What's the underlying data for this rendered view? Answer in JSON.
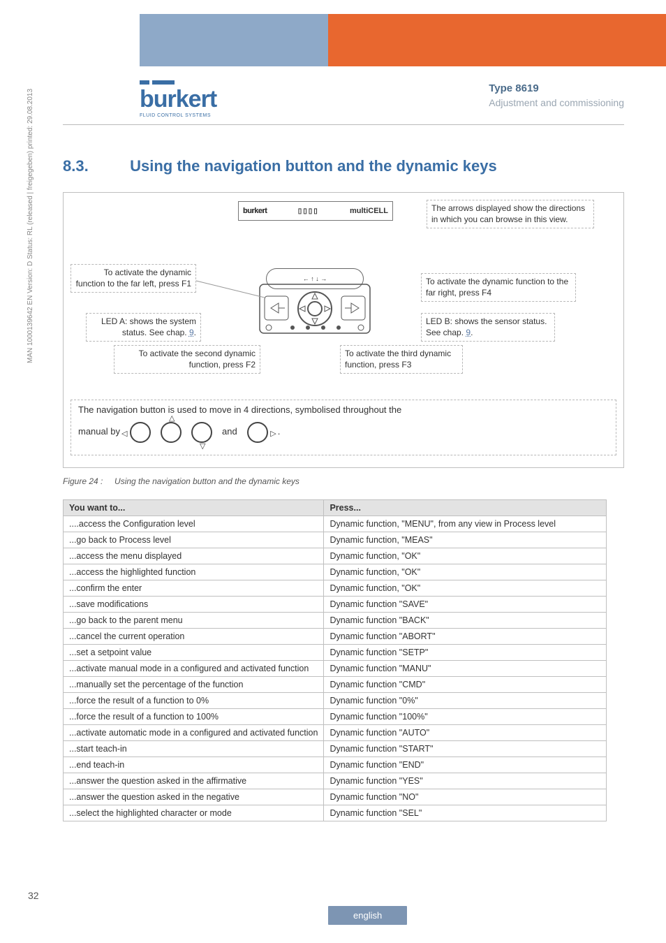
{
  "header": {
    "logo_text": "burkert",
    "logo_sub": "FLUID CONTROL SYSTEMS",
    "type": "Type 8619",
    "subtitle": "Adjustment and commissioning"
  },
  "section": {
    "number": "8.3.",
    "title": "Using the navigation button and the dynamic keys"
  },
  "device": {
    "logo": "burkert",
    "bars": "▯▯▯▯",
    "model": "multiCELL",
    "key_icons": "←  ↑  ↓  →"
  },
  "callouts": {
    "arrows": "The arrows displayed show the directions in which you can browse in this view.",
    "f1": "To activate the dynamic function to the far left, press F1",
    "ledA_pre": "LED A: shows the system status. See chap. ",
    "ledA_chap": "9",
    "ledA_post": ".",
    "f2": "To activate the second dynamic function, press F2",
    "f3": "To activate the third dynamic function, press F3",
    "f4": "To activate the dynamic function to the far right, press F4",
    "ledB_pre": "LED B: shows the sensor status. See chap. ",
    "ledB_chap": "9",
    "ledB_post": ".",
    "nav_pre": "The navigation button is used to move in 4 directions, symbolised throughout the",
    "nav_manual": "manual by",
    "nav_and": "and",
    "nav_dot": "."
  },
  "figure": {
    "label": "Figure 24 :",
    "caption": "Using the navigation button and the dynamic keys"
  },
  "table": {
    "head_left": "You want to...",
    "head_right": "Press...",
    "rows": [
      {
        "l": "....access the Configuration level",
        "r": "Dynamic function, \"MENU\", from any view in Process level"
      },
      {
        "l": "...go back to Process level",
        "r": "Dynamic function, \"MEAS\""
      },
      {
        "l": "...access the menu displayed",
        "r": "Dynamic function, \"OK\""
      },
      {
        "l": "...access the highlighted function",
        "r": "Dynamic function, \"OK\""
      },
      {
        "l": "...confirm the enter",
        "r": "Dynamic function, \"OK\""
      },
      {
        "l": "...save modifications",
        "r": "Dynamic function \"SAVE\""
      },
      {
        "l": "...go back to the parent menu",
        "r": "Dynamic function \"BACK\""
      },
      {
        "l": "...cancel the current operation",
        "r": "Dynamic function \"ABORT\""
      },
      {
        "l": "...set a setpoint value",
        "r": "Dynamic function \"SETP\""
      },
      {
        "l": "...activate manual mode in a configured and activated function",
        "r": "Dynamic function \"MANU\""
      },
      {
        "l": "...manually set the percentage of the function",
        "r": "Dynamic function \"CMD\""
      },
      {
        "l": "...force the result of a function to 0%",
        "r": "Dynamic function \"0%\""
      },
      {
        "l": "...force the result of a function to 100%",
        "r": "Dynamic function \"100%\""
      },
      {
        "l": "...activate automatic mode in a configured and activated function",
        "r": "Dynamic function \"AUTO\""
      },
      {
        "l": "...start teach-in",
        "r": "Dynamic function \"START\""
      },
      {
        "l": "...end teach-in",
        "r": "Dynamic function \"END\""
      },
      {
        "l": "...answer the question asked in the affirmative",
        "r": "Dynamic function \"YES\""
      },
      {
        "l": "...answer the question asked in the negative",
        "r": "Dynamic function \"NO\""
      },
      {
        "l": "...select the highlighted character or mode",
        "r": "Dynamic function \"SEL\""
      }
    ]
  },
  "footer": {
    "side_text": "MAN 1000139642 EN Version: D Status: RL (released | freigegeben) printed: 29.08.2013",
    "page_num": "32",
    "language": "english"
  }
}
